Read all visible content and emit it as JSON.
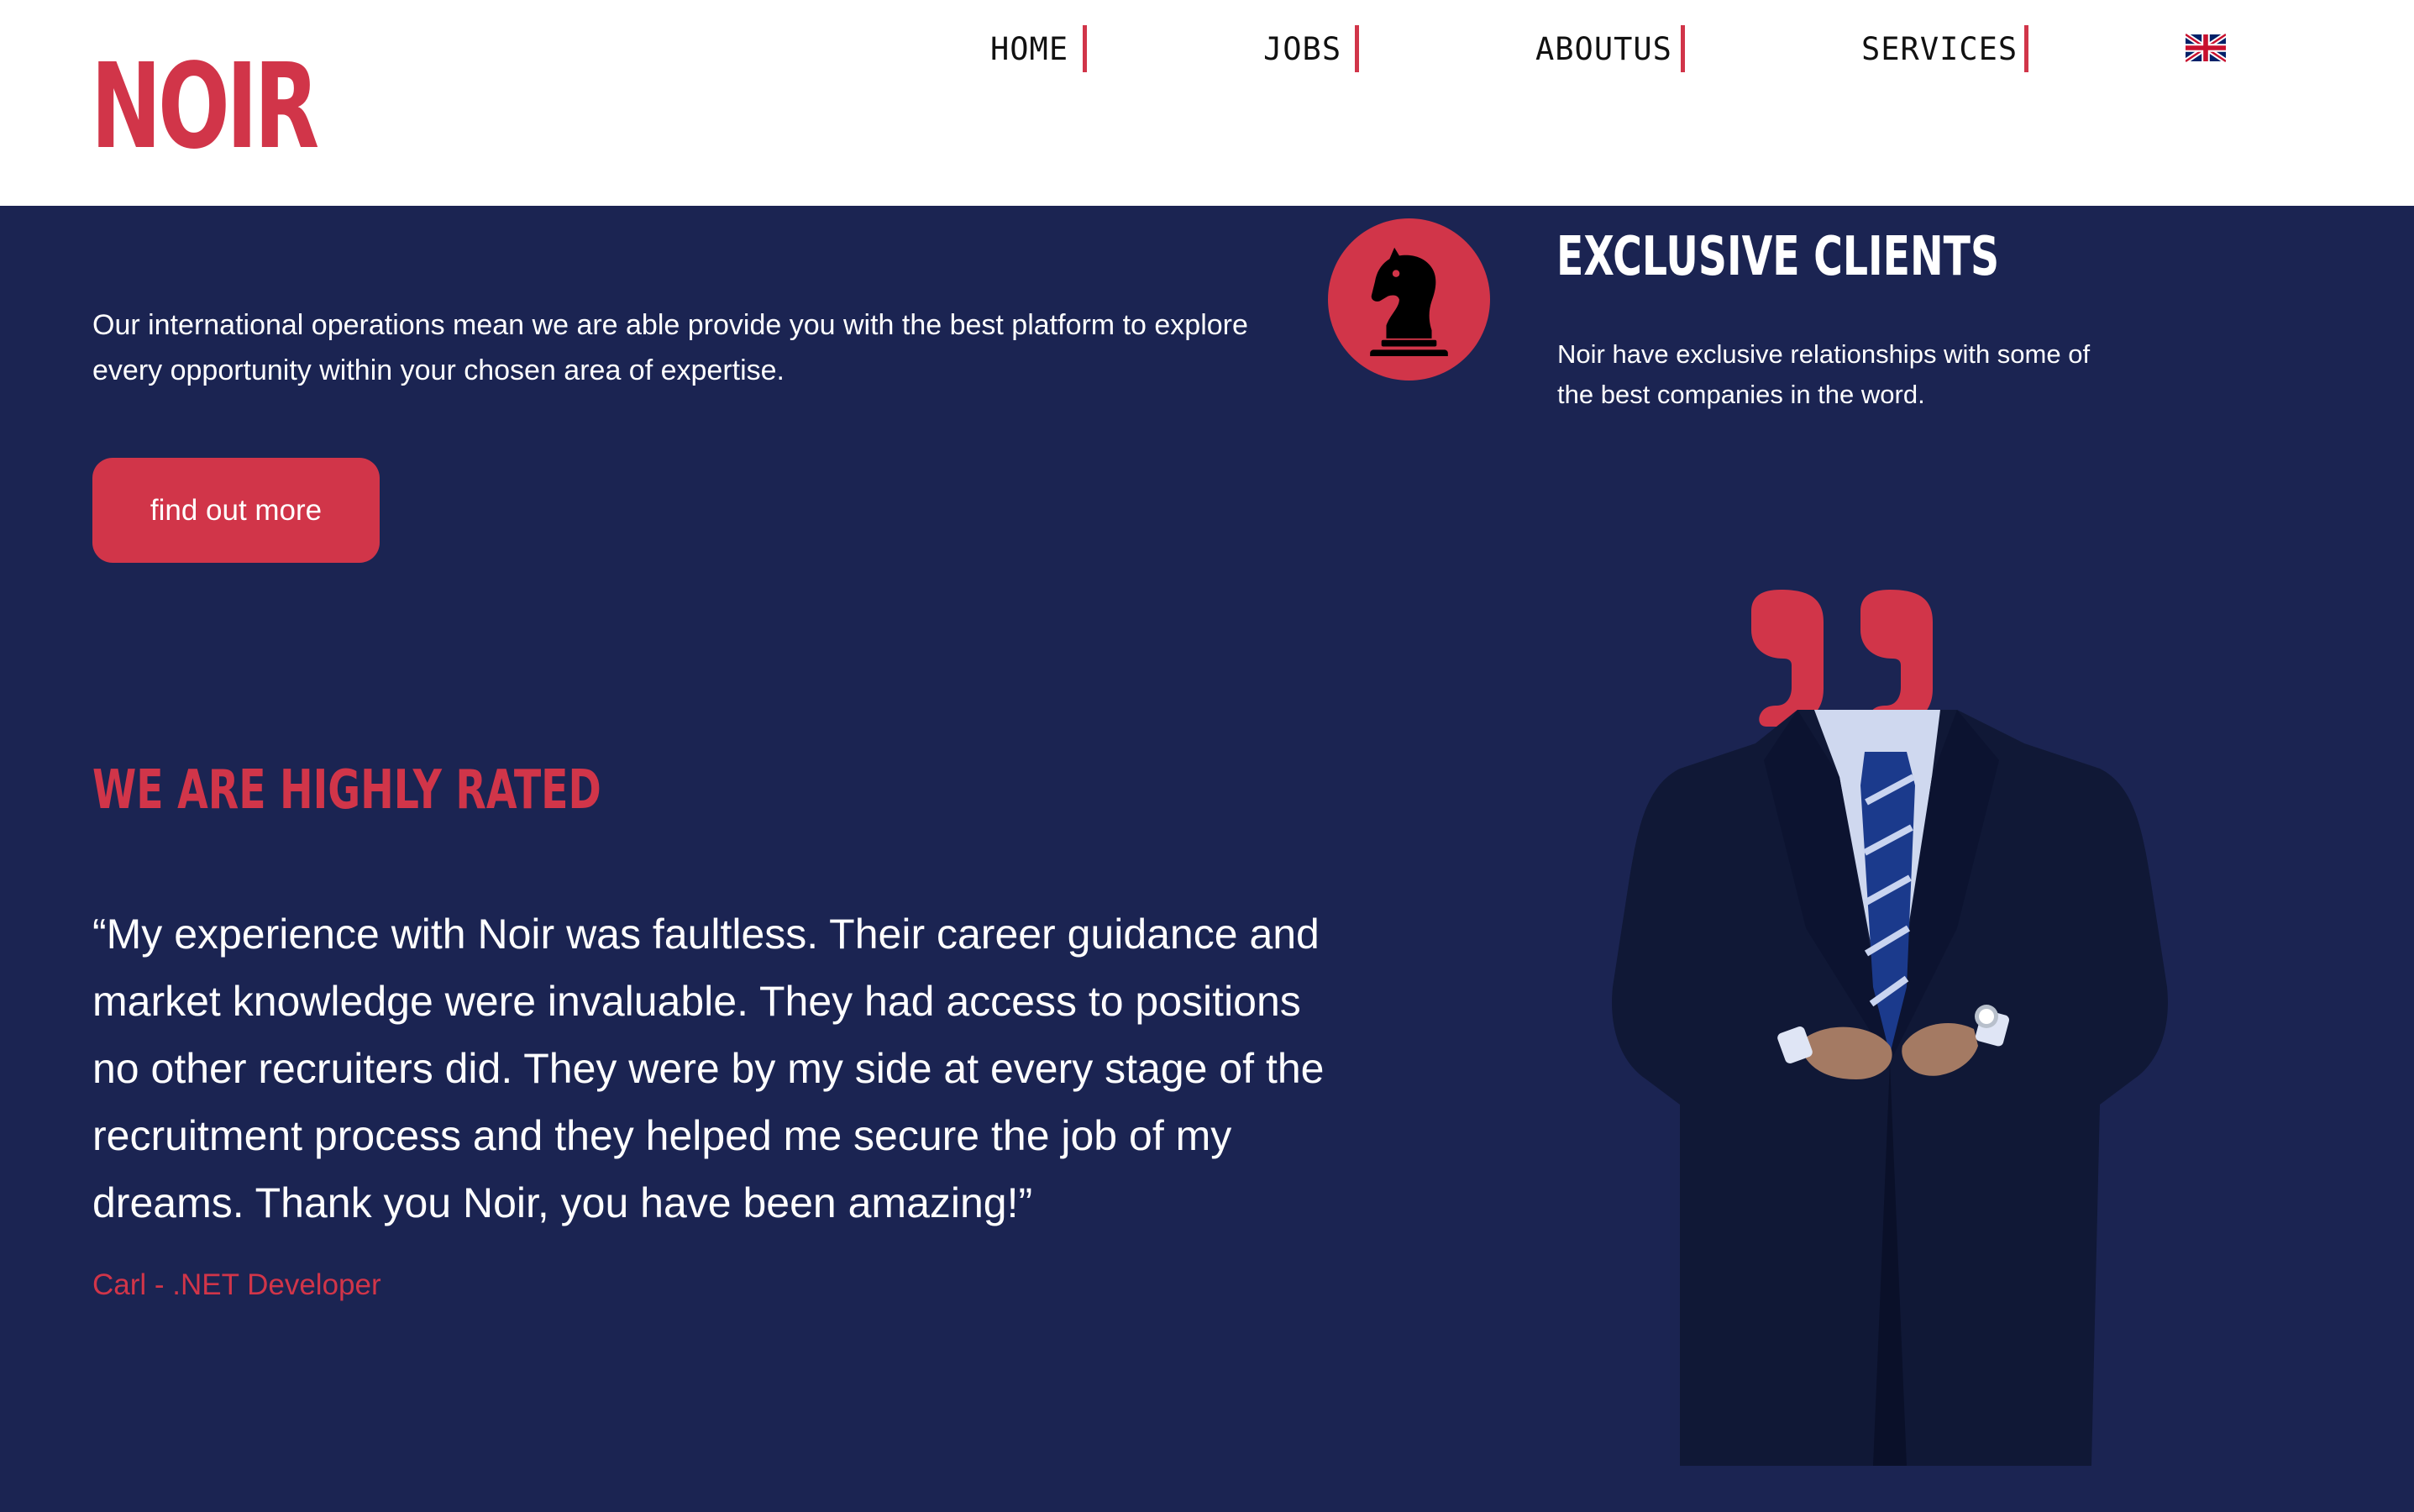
{
  "brand": {
    "logo": "NOIR",
    "accent_color": "#d13549",
    "background_color": "#1b2452"
  },
  "nav": {
    "items": [
      {
        "label": "HOME"
      },
      {
        "label": "JOBS"
      },
      {
        "label": "ABOUTUS"
      },
      {
        "label": "SERVICES"
      }
    ],
    "language_icon": "uk-flag-icon"
  },
  "hero": {
    "intro": "Our international operations mean we are able provide you with the best platform to explore every opportunity within your chosen area of expertise.",
    "button_label": "find out more"
  },
  "clients": {
    "icon": "chess-knight-icon",
    "title": "EXCLUSIVE CLIENTS",
    "text": "Noir have exclusive relationships with some of the best companies in the word."
  },
  "testimonial": {
    "title": "WE ARE HIGHLY RATED",
    "quote": "“My experience with Noir was faultless. Their career guidance and market knowledge were invaluable. They had access to positions no other recruiters did. They were by my side at every stage of the recruitment process and they helped me secure the job of my dreams. Thank you Noir, you have been amazing!”",
    "author": "Carl - .NET Developer",
    "quote_icon": "quote-marks-icon",
    "image": "businessman-in-suit-image"
  }
}
